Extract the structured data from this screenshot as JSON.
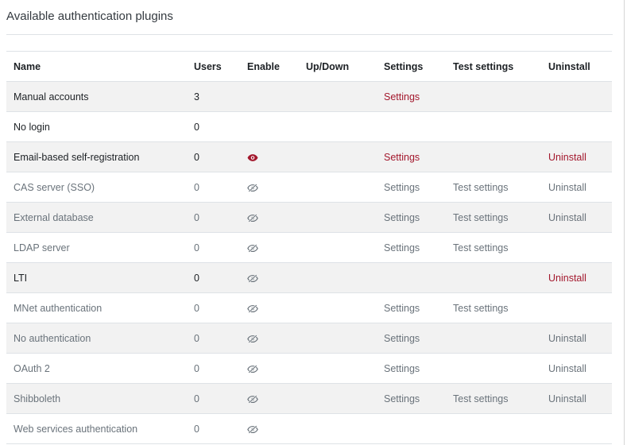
{
  "section": {
    "title": "Available authentication plugins"
  },
  "table": {
    "headers": [
      "Name",
      "Users",
      "Enable",
      "Up/Down",
      "Settings",
      "Test settings",
      "Uninstall"
    ],
    "rows": [
      {
        "name": "Manual accounts",
        "users": "3",
        "enable": "none",
        "settings": "Settings",
        "test": "",
        "uninstall": "",
        "active": true
      },
      {
        "name": "No login",
        "users": "0",
        "enable": "none",
        "settings": "",
        "test": "",
        "uninstall": "",
        "active": true
      },
      {
        "name": "Email-based self-registration",
        "users": "0",
        "enable": "eye-icon",
        "settings": "Settings",
        "test": "",
        "uninstall": "Uninstall",
        "active": true
      },
      {
        "name": "CAS server (SSO)",
        "users": "0",
        "enable": "eye-slash-icon",
        "settings": "Settings",
        "test": "Test settings",
        "uninstall": "Uninstall",
        "active": false
      },
      {
        "name": "External database",
        "users": "0",
        "enable": "eye-slash-icon",
        "settings": "Settings",
        "test": "Test settings",
        "uninstall": "Uninstall",
        "active": false
      },
      {
        "name": "LDAP server",
        "users": "0",
        "enable": "eye-slash-icon",
        "settings": "Settings",
        "test": "Test settings",
        "uninstall": "",
        "active": false
      },
      {
        "name": "LTI",
        "users": "0",
        "enable": "eye-slash-icon",
        "settings": "",
        "test": "",
        "uninstall": "Uninstall",
        "active": true
      },
      {
        "name": "MNet authentication",
        "users": "0",
        "enable": "eye-slash-icon",
        "settings": "Settings",
        "test": "Test settings",
        "uninstall": "",
        "active": false
      },
      {
        "name": "No authentication",
        "users": "0",
        "enable": "eye-slash-icon",
        "settings": "Settings",
        "test": "",
        "uninstall": "Uninstall",
        "active": false
      },
      {
        "name": "OAuth 2",
        "users": "0",
        "enable": "eye-slash-icon",
        "settings": "Settings",
        "test": "",
        "uninstall": "Uninstall",
        "active": false
      },
      {
        "name": "Shibboleth",
        "users": "0",
        "enable": "eye-slash-icon",
        "settings": "Settings",
        "test": "Test settings",
        "uninstall": "Uninstall",
        "active": false
      },
      {
        "name": "Web services authentication",
        "users": "0",
        "enable": "eye-slash-icon",
        "settings": "",
        "test": "",
        "uninstall": "",
        "active": false
      }
    ]
  },
  "colors": {
    "link_active": "#a3182d",
    "text_dimmed": "#6a737b",
    "stripe": "#f2f2f2",
    "border": "#dee2e6"
  }
}
